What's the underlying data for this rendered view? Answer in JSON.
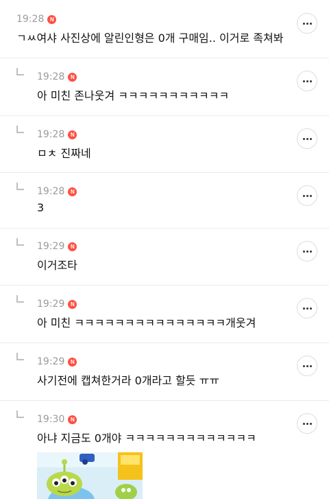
{
  "colors": {
    "badge": "#ff4f42",
    "time": "#9a9a9a",
    "divider": "#ececec"
  },
  "badge_label": "N",
  "comments": [
    {
      "time": "19:28",
      "text": "ㄱㅆ여샤 사진상에 알린인형은 0개 구매임.. 이거로 족쳐봐",
      "is_reply": false
    },
    {
      "time": "19:28",
      "text": "아 미친 존나웃겨 ㅋㅋㅋㅋㅋㅋㅋㅋㅋㅋㅋ",
      "is_reply": true
    },
    {
      "time": "19:28",
      "text": "ㅁㅊ 진짜네",
      "is_reply": true
    },
    {
      "time": "19:28",
      "text": "3",
      "is_reply": true
    },
    {
      "time": "19:29",
      "text": "이거조타",
      "is_reply": true
    },
    {
      "time": "19:29",
      "text": "아 미친 ㅋㅋㅋㅋㅋㅋㅋㅋㅋㅋㅋㅋㅋㅋㅋ개웃겨",
      "is_reply": true
    },
    {
      "time": "19:29",
      "text": "사기전에 캡쳐한거라 0개라고 할듯 ㅠㅠ",
      "is_reply": true
    },
    {
      "time": "19:30",
      "text": "아냐 지금도 0개야 ㅋㅋㅋㅋㅋㅋㅋㅋㅋㅋㅋㅋㅋ",
      "is_reply": true
    }
  ],
  "icons": {
    "reply": "reply-arrow-icon",
    "more": "more-options-icon",
    "badge": "new-badge-icon"
  }
}
